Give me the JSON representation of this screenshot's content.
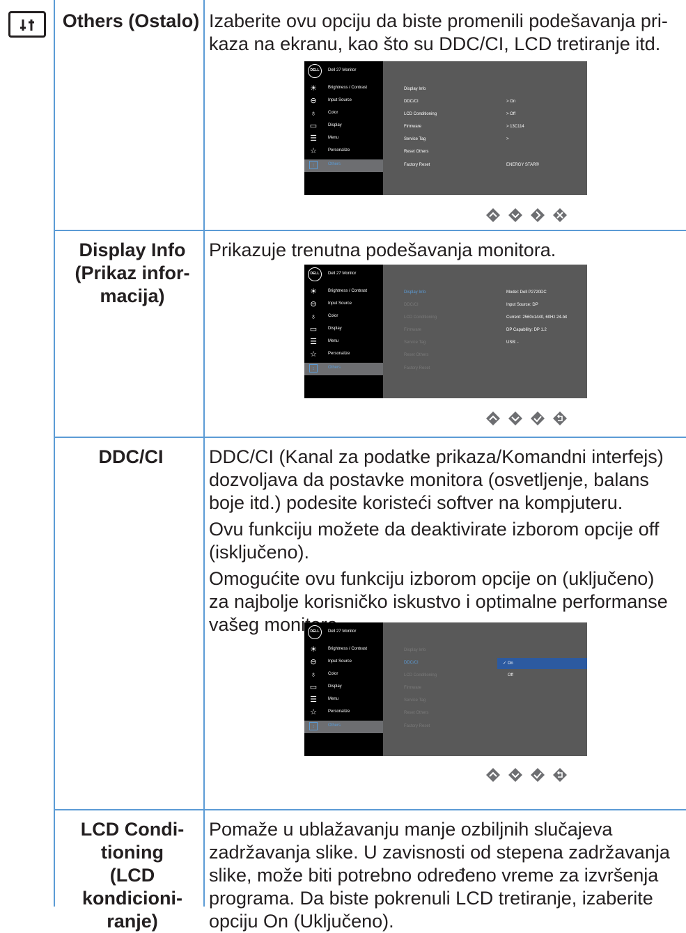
{
  "rows": [
    {
      "label": "Others (Ostalo)",
      "description": "Izaberite ovu opciju da biste promenili podešavanja pri- kaza na ekranu, kao što su DDC/CI, LCD tretiranje itd."
    },
    {
      "label": "Display Info (Prikaz infor- macija)",
      "description": "Prikazuje trenutna podešavanja monitora."
    },
    {
      "label": "DDC/CI",
      "paragraphs": [
        "DDC/CI (Kanal za podatke prikaza/Komandni interfejs) dozvoljava da postavke monitora (osvetljenje, balans boje itd.) podesite koristeći softver na kompjuteru.",
        "Ovu funkciju možete da deaktivirate izborom opcije off (isključeno).",
        "Omogućite ovu funkciju izborom opcije on (uključeno) za najbolje korisničko iskustvo i optimalne performanse vašeg monitora."
      ]
    },
    {
      "label": "LCD Condi- tioning (LCD kondicioni- ranje)",
      "description": "Pomaže u ublažavanju manje ozbiljnih slučajeva zadržavanja slike. U zavisnosti od stepena zadržavanja slike, može biti potrebno određeno vreme za izvršenja programa. Da biste pokrenuli LCD tretiranje, izaberite opciju On (Uključeno)."
    }
  ],
  "osd": {
    "logo": "DELL",
    "title": "Dell 27 Monitor",
    "menu": [
      "Brightness / Contrast",
      "Input Source",
      "Color",
      "Display",
      "Menu",
      "Personalize",
      "Others"
    ],
    "menu_icons": [
      "sun-icon",
      "input-icon",
      "color-icon",
      "display-icon",
      "menu-icon",
      "star-icon",
      "others-icon"
    ],
    "submenu": [
      "Display Info",
      "DDC/CI",
      "LCD Conditioning",
      "Firmware",
      "Service Tag",
      "Reset Others",
      "Factory Reset"
    ],
    "others_values": [
      "",
      "> On",
      "> Off",
      "> 13C114",
      ">",
      "",
      "ENERGY STAR®"
    ],
    "info_values": [
      "Model: Dell P2720DC",
      "Input Source: DP",
      "Current: 2560x1440, 60Hz 24-bit",
      "DP Capability: DP 1.2",
      "USB: -"
    ],
    "ddc_options": [
      "✓ On",
      "Off"
    ]
  },
  "nav_icons": {
    "row1": [
      "up-icon",
      "down-icon",
      "right-icon",
      "close-icon"
    ],
    "row2": [
      "up-icon",
      "down-icon",
      "check-icon",
      "back-icon"
    ],
    "row3": [
      "up-icon",
      "down-icon",
      "check-icon",
      "back-icon"
    ]
  }
}
